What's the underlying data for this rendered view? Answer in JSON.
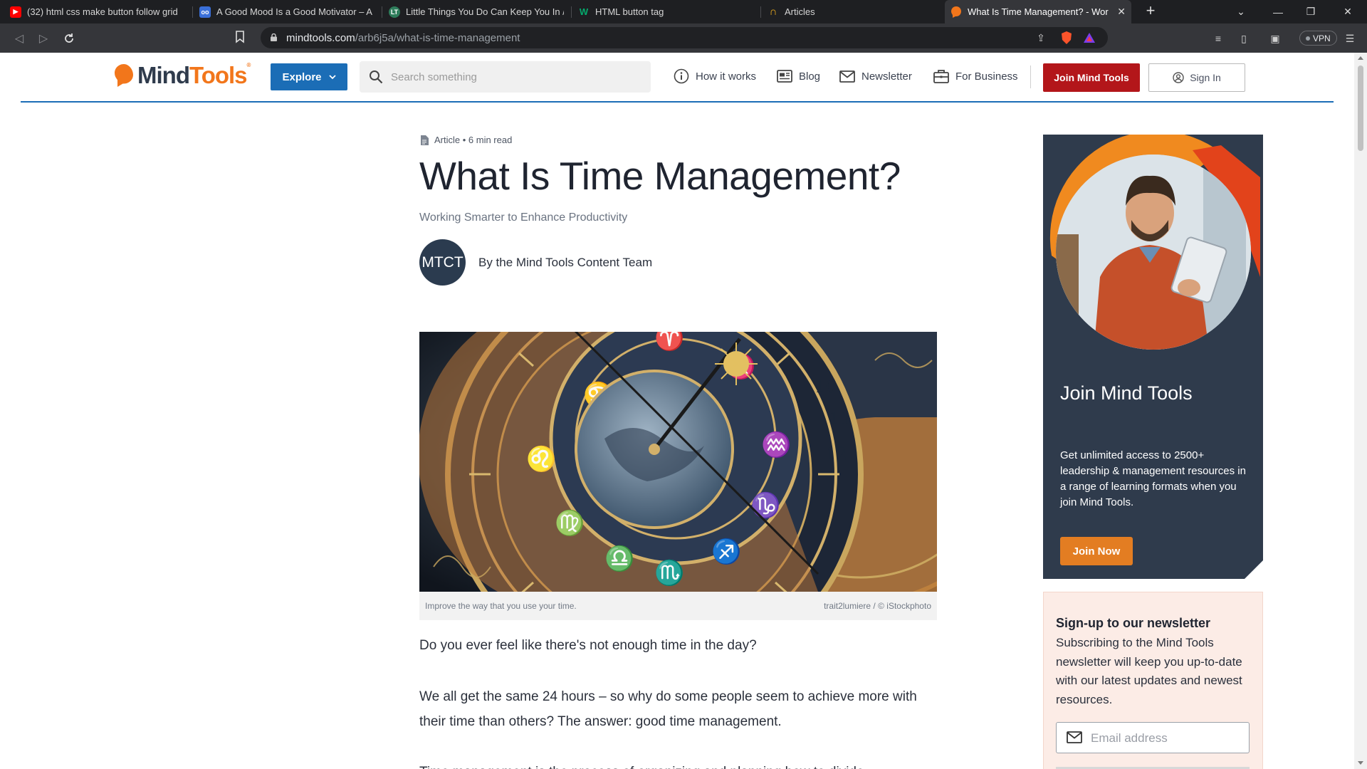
{
  "browser": {
    "tabs": [
      {
        "title": "(32) html css make button follow grid",
        "favicon": "youtube-icon",
        "color": "#ff0000"
      },
      {
        "title": "A Good Mood Is a Good Motivator – A",
        "favicon": "glasses-icon",
        "color": "#3a6fd8"
      },
      {
        "title": "Little Things You Do Can Keep You In /",
        "favicon": "lt-icon",
        "color": "#2e7d5b"
      },
      {
        "title": "HTML button tag",
        "favicon": "w3schools-icon",
        "color": "#04aa6d"
      },
      {
        "title": "Articles",
        "favicon": "arch-icon",
        "color": "#f2b01e"
      },
      {
        "title": "What Is Time Management? - Wor",
        "favicon": "mindtools-icon",
        "color": "#f2761b"
      }
    ],
    "url_domain": "mindtools.com",
    "url_path": "/arb6j5a/what-is-time-management",
    "vpn_label": "VPN"
  },
  "header": {
    "logo_mind": "Mind",
    "logo_tools": "Tools",
    "logo_reg": "®",
    "explore_label": "Explore",
    "search_placeholder": "Search something",
    "nav": {
      "how_it_works": "How it works",
      "blog": "Blog",
      "newsletter": "Newsletter",
      "for_business": "For Business"
    },
    "join_label": "Join Mind Tools",
    "signin_label": "Sign In"
  },
  "article": {
    "meta": "Article • 6 min read",
    "title": "What Is Time Management?",
    "subtitle": "Working Smarter to Enhance Productivity",
    "author_initials": "MTCT",
    "author_line": "By the Mind Tools Content Team",
    "caption": "Improve the way that you use your time.",
    "credit": "trait2lumiere / © iStockphoto",
    "p1": "Do you ever feel like there's not enough time in the day?",
    "p2": "We all get the same 24 hours – so why do some people seem to achieve more with their time than others? The answer: good time management.",
    "p3": "Time management is the process of organizing and planning how to divide"
  },
  "sidebar": {
    "promo_title": "Join Mind Tools",
    "promo_text": "Get unlimited access to 2500+ leadership & management resources in a range of learning formats when you join Mind Tools.",
    "promo_button": "Join Now",
    "newsletter_title": "Sign-up to our newsletter",
    "newsletter_text": "Subscribing to the Mind Tools newsletter will keep you up-to-date with our latest updates and newest resources.",
    "email_placeholder": "Email address"
  },
  "colors": {
    "brand_orange": "#f2761b",
    "brand_blue": "#1b6db6",
    "join_red": "#b3161a",
    "promo_navy": "#2f3b4c",
    "promo_button": "#e37d22"
  }
}
